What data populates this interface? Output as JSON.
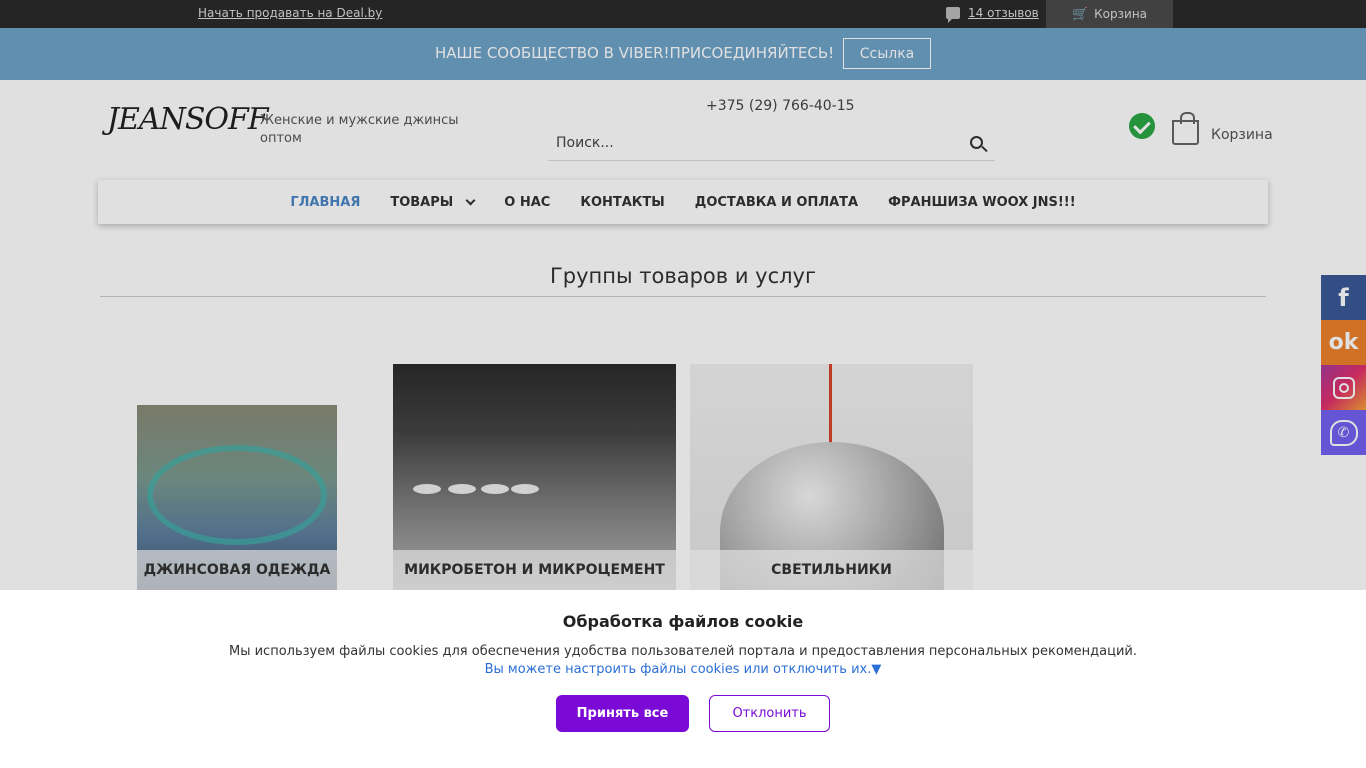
{
  "topbar": {
    "sell_link": "Начать продавать на Deal.by",
    "reviews": "14 отзывов",
    "cart": "Корзина"
  },
  "banner": {
    "message": "НАШЕ СООБЩЕСТВО В VIBER!ПРИСОЕДИНЯЙТЕСЬ!",
    "button": "Ссылка"
  },
  "header": {
    "logo": "JEANSOFF",
    "tagline": "Женские и мужские джинсы оптом",
    "phone": "+375 (29) 766-40-15",
    "search_placeholder": "Поиск...",
    "cart_label": "Корзина"
  },
  "nav": {
    "items": [
      {
        "label": "ГЛАВНАЯ"
      },
      {
        "label": "ТОВАРЫ"
      },
      {
        "label": "О НАС"
      },
      {
        "label": "КОНТАКТЫ"
      },
      {
        "label": "ДОСТАВКА И ОПЛАТА"
      },
      {
        "label": "ФРАНШИЗА WOOX JNS!!!"
      }
    ]
  },
  "section": {
    "title": "Группы товаров и услуг"
  },
  "products": [
    {
      "label": "ДЖИНСОВАЯ ОДЕЖДА"
    },
    {
      "label": "МИКРОБЕТОН И МИКРОЦЕМЕНТ"
    },
    {
      "label": "СВЕТИЛЬНИКИ"
    }
  ],
  "social": {
    "facebook": "f",
    "ok": "ok"
  },
  "cookie": {
    "title": "Обработка файлов cookie",
    "text": "Мы используем файлы cookies для обеспечения удобства пользователей портала и предоставления персональных рекомендаций.",
    "link": "Вы можете настроить файлы cookies или отключить их.▼",
    "accept": "Принять все",
    "decline": "Отклонить"
  },
  "colors": {
    "banner": "#6fa3c9",
    "nav_active": "#4a86c5",
    "accent_purple": "#7b0ad6",
    "facebook": "#3b5998",
    "ok": "#ed812b",
    "viber": "#7360f2"
  }
}
